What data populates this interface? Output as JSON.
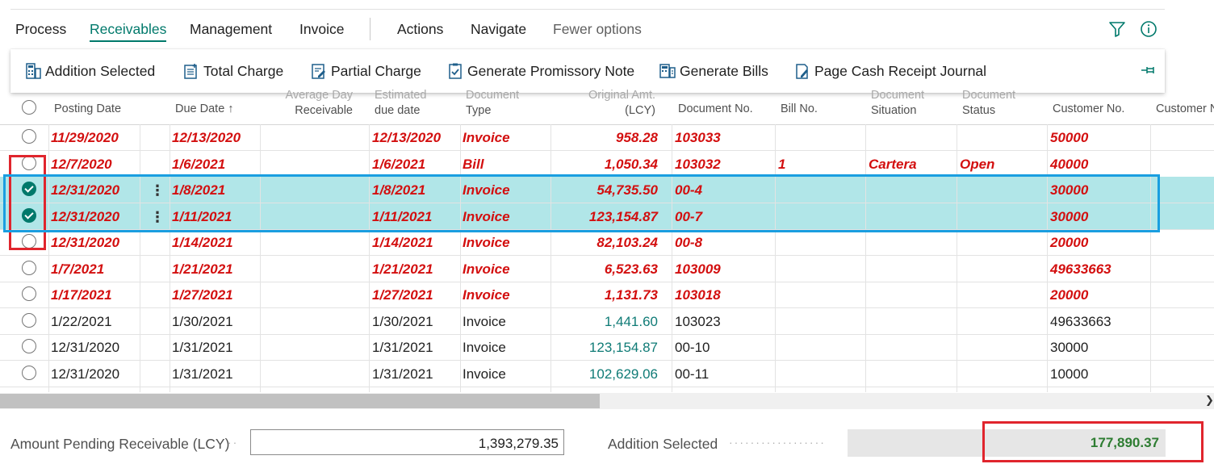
{
  "menu": {
    "items": [
      "Process",
      "Receivables",
      "Management",
      "Invoice",
      "Actions",
      "Navigate"
    ],
    "active_index": 1,
    "fewer_options": "Fewer options"
  },
  "actions": [
    "Addition Selected",
    "Total Charge",
    "Partial Charge",
    "Generate Promissory Note",
    "Generate Bills",
    "Page Cash Receipt Journal"
  ],
  "columns": {
    "posting_date": "Posting Date",
    "due_date": "Due Date",
    "sort_arrow": "↑",
    "avg_day_top": "Average Day",
    "avg_day_bottom": "Receivable",
    "estimated_top": "Estimated",
    "estimated_bottom": "due date",
    "doc_type_top": "Document",
    "doc_type_bottom": "Type",
    "orig_amt_top": "Original Amt.",
    "orig_amt_bottom": "(LCY)",
    "document_no": "Document No.",
    "bill_no": "Bill No.",
    "doc_situation_top": "Document",
    "doc_situation_bottom": "Situation",
    "doc_status_top": "Document",
    "doc_status_bottom": "Status",
    "customer_no": "Customer No.",
    "customer_name": "Customer N"
  },
  "rows": [
    {
      "posting": "11/29/2020",
      "due": "12/13/2020",
      "est": "12/13/2020",
      "type": "Invoice",
      "amt": "958.28",
      "docno": "103033",
      "bill": "",
      "situation": "",
      "status": "",
      "customer": "50000"
    },
    {
      "posting": "12/7/2020",
      "due": "1/6/2021",
      "est": "1/6/2021",
      "type": "Bill",
      "amt": "1,050.34",
      "docno": "103032",
      "bill": "1",
      "situation": "Cartera",
      "status": "Open",
      "customer": "40000"
    },
    {
      "posting": "12/31/2020",
      "due": "1/8/2021",
      "est": "1/8/2021",
      "type": "Invoice",
      "amt": "54,735.50",
      "docno": "00-4",
      "bill": "",
      "situation": "",
      "status": "",
      "customer": "30000"
    },
    {
      "posting": "12/31/2020",
      "due": "1/11/2021",
      "est": "1/11/2021",
      "type": "Invoice",
      "amt": "123,154.87",
      "docno": "00-7",
      "bill": "",
      "situation": "",
      "status": "",
      "customer": "30000"
    },
    {
      "posting": "12/31/2020",
      "due": "1/14/2021",
      "est": "1/14/2021",
      "type": "Invoice",
      "amt": "82,103.24",
      "docno": "00-8",
      "bill": "",
      "situation": "",
      "status": "",
      "customer": "20000"
    },
    {
      "posting": "1/7/2021",
      "due": "1/21/2021",
      "est": "1/21/2021",
      "type": "Invoice",
      "amt": "6,523.63",
      "docno": "103009",
      "bill": "",
      "situation": "",
      "status": "",
      "customer": "49633663"
    },
    {
      "posting": "1/17/2021",
      "due": "1/27/2021",
      "est": "1/27/2021",
      "type": "Invoice",
      "amt": "1,131.73",
      "docno": "103018",
      "bill": "",
      "situation": "",
      "status": "",
      "customer": "20000"
    },
    {
      "posting": "1/22/2021",
      "due": "1/30/2021",
      "est": "1/30/2021",
      "type": "Invoice",
      "amt": "1,441.60",
      "docno": "103023",
      "bill": "",
      "situation": "",
      "status": "",
      "customer": "49633663"
    },
    {
      "posting": "12/31/2020",
      "due": "1/31/2021",
      "est": "1/31/2021",
      "type": "Invoice",
      "amt": "123,154.87",
      "docno": "00-10",
      "bill": "",
      "situation": "",
      "status": "",
      "customer": "30000"
    },
    {
      "posting": "12/31/2020",
      "due": "1/31/2021",
      "est": "1/31/2021",
      "type": "Invoice",
      "amt": "102,629.06",
      "docno": "00-11",
      "bill": "",
      "situation": "",
      "status": "",
      "customer": "10000"
    }
  ],
  "selected_rows": [
    2,
    3
  ],
  "overdue_rows": [
    0,
    1,
    2,
    3,
    4,
    5,
    6
  ],
  "footer": {
    "amount_label": "Amount Pending Receivable (LCY)",
    "amount_value": "1,393,279.35",
    "addition_label": "Addition Selected",
    "addition_value": "177,890.37"
  },
  "colors": {
    "accent": "#00796b",
    "overdue": "#d30f0f",
    "selected_row": "#b1e6e8",
    "highlight_red": "#e0252d",
    "highlight_blue": "#1a9ee0"
  }
}
